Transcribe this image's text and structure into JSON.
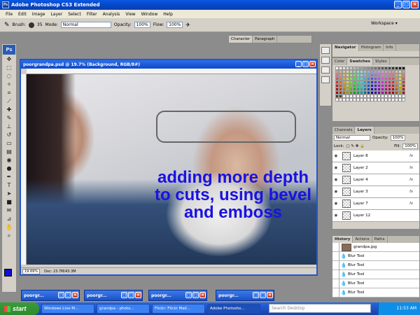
{
  "app": {
    "title": "Adobe Photoshop CS3 Extended",
    "logo": "Ps"
  },
  "menu": [
    "File",
    "Edit",
    "Image",
    "Layer",
    "Select",
    "Filter",
    "Analysis",
    "View",
    "Window",
    "Help"
  ],
  "options": {
    "brush_label": "Brush:",
    "brush_size": "35",
    "mode_label": "Mode:",
    "mode_value": "Normal",
    "opacity_label": "Opacity:",
    "opacity_value": "100%",
    "flow_label": "Flow:",
    "flow_value": "100%",
    "workspace_label": "Workspace ▾"
  },
  "char_panel": {
    "tabs": [
      "Character",
      "Paragraph"
    ]
  },
  "document": {
    "title": "poorgrandpa.psd @ 19.7% (Background, RGB/8#)",
    "overlay_text": "adding more depth to cuts, using bevel and emboss",
    "zoom": "19.69%",
    "doc_info": "Doc: 23.7M/43.3M"
  },
  "navigator_panel": {
    "tabs": [
      "Navigator",
      "Histogram",
      "Info"
    ]
  },
  "swatches_panel": {
    "tabs": [
      "Color",
      "Swatches",
      "Styles"
    ]
  },
  "layers_panel": {
    "tabs": [
      "Channels",
      "Layers"
    ],
    "blend_mode": "Normal",
    "opacity_label": "Opacity:",
    "opacity_value": "100%",
    "lock_label": "Lock:",
    "fill_label": "Fill:",
    "fill_value": "100%",
    "layers": [
      {
        "name": "Layer 8",
        "fx": "fx"
      },
      {
        "name": "Layer 2",
        "fx": "fx"
      },
      {
        "name": "Layer 4",
        "fx": "fx"
      },
      {
        "name": "Layer 3",
        "fx": "fx"
      },
      {
        "name": "Layer 7",
        "fx": "fx"
      },
      {
        "name": "Layer 12",
        "fx": ""
      }
    ]
  },
  "history_panel": {
    "tabs": [
      "History",
      "Actions",
      "Paths"
    ],
    "snapshot": "grandpa.jpg",
    "items": [
      "Blur Tool",
      "Blur Tool",
      "Blur Tool",
      "Blur Tool",
      "Blur Tool"
    ]
  },
  "minimized_docs": [
    "poorgr...",
    "poorgr...",
    "poorgr...",
    "poorgr..."
  ],
  "taskbar": {
    "start": "start",
    "items": [
      "Windows Live M...",
      "grandpa - photo...",
      "Flickr: Flickr Mail...",
      "Adobe Photosho..."
    ],
    "search_placeholder": "Search Desktop",
    "clock": "11:53 AM"
  },
  "colors": {
    "foreground": "#1010d0",
    "background": "#ffffff",
    "overlay_text": "#1a12e0"
  }
}
